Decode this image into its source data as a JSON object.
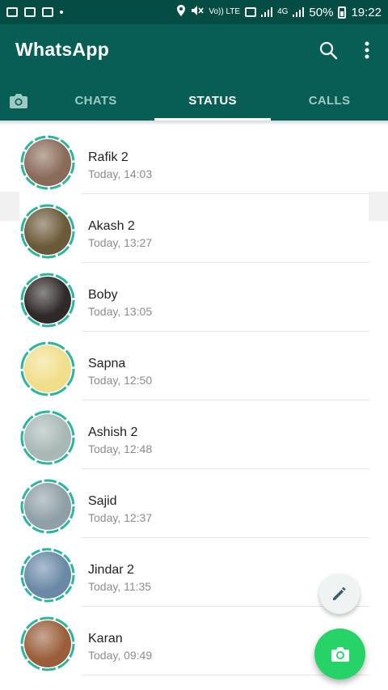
{
  "status_bar": {
    "battery": "50%",
    "time": "19:22",
    "network_volte": "Vo)) LTE",
    "network_4g": "4G"
  },
  "app": {
    "title": "WhatsApp",
    "brand_color": "#075e54",
    "accent_color": "#25d366"
  },
  "tabs": [
    {
      "label": "",
      "icon": "camera-icon",
      "active": false
    },
    {
      "label": "CHATS",
      "active": false
    },
    {
      "label": "STATUS",
      "active": true
    },
    {
      "label": "CALLS",
      "active": false
    }
  ],
  "statuses": [
    {
      "name": "Rafik 2",
      "time": "Today, 14:03",
      "avatar_color": "#8a6b5a"
    },
    {
      "name": "Akash 2",
      "time": "Today, 13:27",
      "avatar_color": "#6b5a3a"
    },
    {
      "name": "Boby",
      "time": "Today, 13:05",
      "avatar_color": "#2e2a28"
    },
    {
      "name": "Sapna",
      "time": "Today, 12:50",
      "avatar_color": "#f1de8a"
    },
    {
      "name": "Ashish 2",
      "time": "Today, 12:48",
      "avatar_color": "#a7b8b5"
    },
    {
      "name": "Sajid",
      "time": "Today, 12:37",
      "avatar_color": "#8e9fa7"
    },
    {
      "name": "Jindar 2",
      "time": "Today, 11:35",
      "avatar_color": "#6a89a6"
    },
    {
      "name": "Karan",
      "time": "Today, 09:49",
      "avatar_color": "#9a5f3a"
    }
  ],
  "fab": {
    "pencil_icon": "pencil-icon",
    "camera_icon": "camera-icon"
  }
}
